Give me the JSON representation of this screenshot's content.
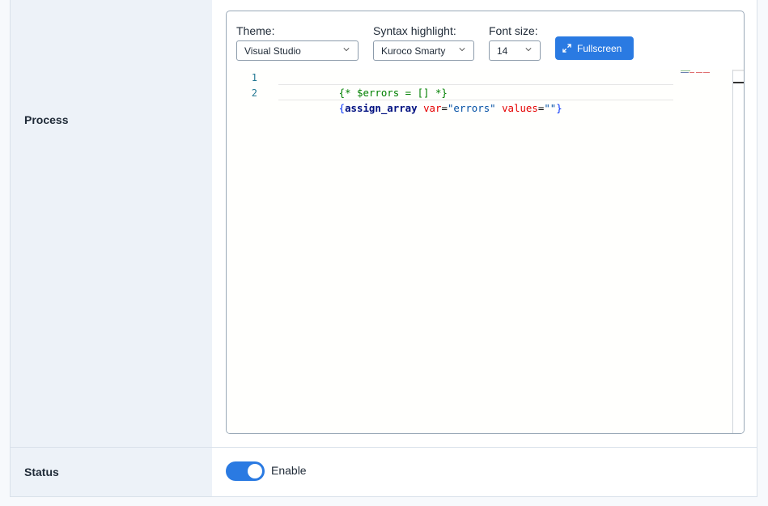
{
  "process": {
    "label": "Process",
    "theme": {
      "label": "Theme:",
      "value": "Visual Studio"
    },
    "syntax": {
      "label": "Syntax highlight:",
      "value": "Kuroco Smarty"
    },
    "font_size": {
      "label": "Font size:",
      "value": "14"
    },
    "fullscreen_label": "Fullscreen",
    "code_lines": [
      {
        "number": "1",
        "text": "{* $errors = [] *}"
      },
      {
        "number": "2",
        "text": "{assign_array var=\"errors\" values=\"\"}"
      }
    ]
  },
  "status": {
    "label": "Status",
    "toggle_label": "Enable",
    "enabled": true
  },
  "colors": {
    "accent": "#2a7ae2",
    "label_bg": "#edf2f8",
    "border": "#d9e1ea"
  },
  "icons": {
    "fullscreen": "expand-arrows-icon",
    "select_chevron": "chevron-down-icon"
  }
}
